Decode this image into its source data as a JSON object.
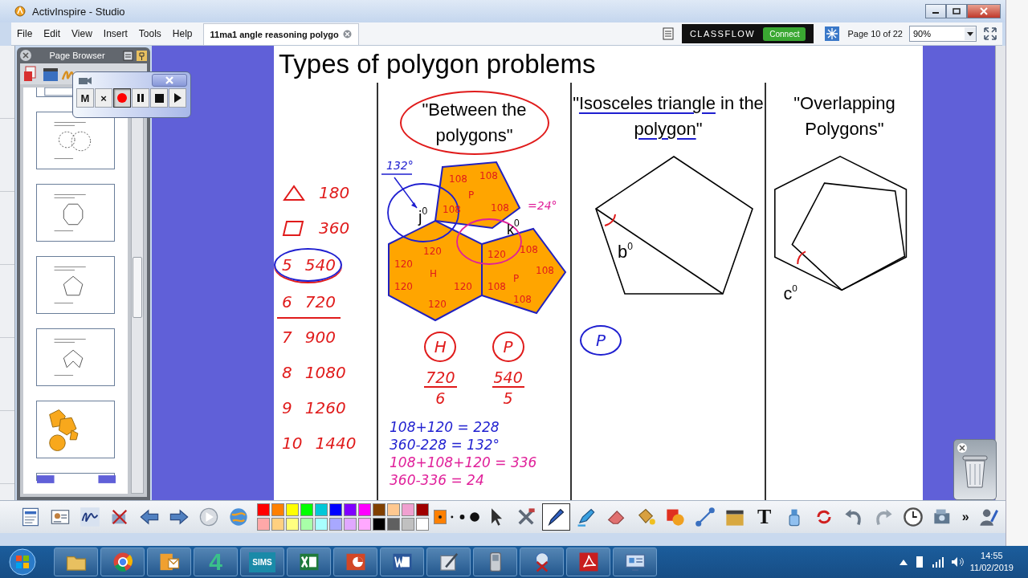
{
  "window": {
    "title": "ActivInspire - Studio"
  },
  "menu": [
    "File",
    "Edit",
    "View",
    "Insert",
    "Tools",
    "Help"
  ],
  "document_tab": {
    "title": "11ma1 angle reasoning polygo"
  },
  "classflow": {
    "logo": "CLASSFLOW",
    "button": "Connect"
  },
  "page_indicator": "Page 10 of 22",
  "zoom": {
    "value": "90%"
  },
  "page_browser": {
    "title": "Page Browser",
    "thumbnails": [
      {
        "kind": "blank"
      },
      {
        "kind": "circles"
      },
      {
        "kind": "octagon"
      },
      {
        "kind": "pentagon"
      },
      {
        "kind": "arrow"
      },
      {
        "kind": "orange"
      },
      {
        "kind": "purple"
      }
    ]
  },
  "recorder": {
    "buttons": [
      {
        "kind": "text",
        "label": "M",
        "selected": false
      },
      {
        "kind": "text",
        "label": "×",
        "selected": false
      },
      {
        "kind": "record",
        "selected": true
      },
      {
        "kind": "pause",
        "selected": false
      },
      {
        "kind": "stop",
        "selected": false
      },
      {
        "kind": "play",
        "selected": false
      }
    ]
  },
  "page": {
    "title": "Types of polygon problems",
    "angle_sums": [
      {
        "kind": "triangle",
        "total": "180",
        "circled": false,
        "underlined": false
      },
      {
        "kind": "square",
        "total": "360",
        "circled": false,
        "underlined": false
      },
      {
        "kind": "number",
        "sides": "5",
        "total": "540",
        "circled": true,
        "underlined": true
      },
      {
        "kind": "number",
        "sides": "6",
        "total": "720",
        "circled": false,
        "underlined": true
      },
      {
        "kind": "number",
        "sides": "7",
        "total": "900",
        "circled": false,
        "underlined": false
      },
      {
        "kind": "number",
        "sides": "8",
        "total": "1080",
        "circled": false,
        "underlined": false
      },
      {
        "kind": "number",
        "sides": "9",
        "total": "1260",
        "circled": false,
        "underlined": false
      },
      {
        "kind": "number",
        "sides": "10",
        "total": "1440",
        "circled": false,
        "underlined": false
      }
    ],
    "between": {
      "heading": "\"Between the polygons\"",
      "note": "132°",
      "j": {
        "letter": "j",
        "exponent": "0"
      },
      "k": {
        "letter": "k",
        "exponent": "0"
      },
      "k_note": "=24°",
      "shapes": [
        {
          "kind": "pentagon",
          "labels": [
            {
              "text": "108",
              "color": "#e01b1b"
            },
            {
              "text": "108",
              "color": "#e01b1b"
            },
            {
              "text": "P",
              "color": "#e01b1b"
            },
            {
              "text": "108",
              "color": "#e01b1b"
            },
            {
              "text": "108",
              "color": "#e01b1b"
            }
          ]
        },
        {
          "kind": "hexagon",
          "labels": [
            {
              "text": "120",
              "color": "#e01b1b"
            },
            {
              "text": "120",
              "color": "#e01b1b"
            },
            {
              "text": "H",
              "color": "#e01b1b"
            },
            {
              "text": "120",
              "color": "#e01b1b"
            },
            {
              "text": "120",
              "color": "#e01b1b"
            },
            {
              "text": "120",
              "color": "#e01b1b"
            }
          ]
        },
        {
          "kind": "pentagon",
          "labels": [
            {
              "text": "120",
              "color": "#e01b1b"
            },
            {
              "text": "108",
              "color": "#e01b1b"
            },
            {
              "text": "P",
              "color": "#e01b1b"
            },
            {
              "text": "108",
              "color": "#e01b1b"
            },
            {
              "text": "108",
              "color": "#e01b1b"
            },
            {
              "text": "108",
              "color": "#e01b1b"
            }
          ]
        }
      ],
      "fractions": [
        {
          "label": "H",
          "numerator": "720",
          "denominator": "6"
        },
        {
          "label": "P",
          "numerator": "540",
          "denominator": "5"
        }
      ],
      "working": [
        {
          "text": "108+120 = 228",
          "color": "#1f1fd0"
        },
        {
          "text": "360-228 = 132°",
          "color": "#1f1fd0"
        },
        {
          "text": "108+108+120 = 336",
          "color": "#e0209a"
        },
        {
          "text": "360-336 = 24",
          "color": "#e0209a"
        }
      ]
    },
    "isosceles": {
      "heading_parts": [
        {
          "text": "\"",
          "underlined": false
        },
        {
          "text": "Isosceles triangle",
          "underlined": true
        },
        {
          "text": " in the ",
          "underlined": false
        },
        {
          "text": "polygon",
          "underlined": true
        },
        {
          "text": "\"",
          "underlined": false
        }
      ],
      "angle": {
        "letter": "b",
        "exponent": "0"
      },
      "note": "P"
    },
    "overlapping": {
      "heading": "\"Overlapping Polygons\"",
      "angle": {
        "letter": "c",
        "exponent": "0"
      }
    }
  },
  "toolbar": {
    "left": [
      {
        "kind": "flipchart"
      },
      {
        "kind": "profile"
      },
      {
        "kind": "signature"
      },
      {
        "kind": "toolbox"
      },
      {
        "kind": "back"
      },
      {
        "kind": "forward"
      },
      {
        "kind": "play"
      },
      {
        "kind": "globe"
      }
    ],
    "palette": [
      {
        "color": "#ff0000"
      },
      {
        "color": "#ff8000"
      },
      {
        "color": "#ffff00"
      },
      {
        "color": "#00ff00"
      },
      {
        "color": "#00c8d8"
      },
      {
        "color": "#0000ff"
      },
      {
        "color": "#8000ff"
      },
      {
        "color": "#ff00ff"
      },
      {
        "color": "#804000"
      },
      {
        "color": "#ffc890"
      },
      {
        "color": "#f0a0d0"
      },
      {
        "color": "#a00000"
      },
      {
        "color": "#ffa8a8"
      },
      {
        "color": "#ffd080"
      },
      {
        "color": "#ffff80"
      },
      {
        "color": "#a8ffa8"
      },
      {
        "color": "#a8ffff"
      },
      {
        "color": "#a8a8ff"
      },
      {
        "color": "#e0a8ff"
      },
      {
        "color": "#ffa8ff"
      },
      {
        "color": "#000000"
      },
      {
        "color": "#606060"
      },
      {
        "color": "#c0c0c0"
      },
      {
        "color": "#ffffff"
      }
    ],
    "current": {
      "color": "#ff8000"
    },
    "tools": [
      {
        "kind": "pointer",
        "selected": false
      },
      {
        "kind": "tools",
        "selected": false
      },
      {
        "kind": "pen",
        "selected": true
      },
      {
        "kind": "highlighter",
        "selected": false
      },
      {
        "kind": "eraser",
        "selected": false
      },
      {
        "kind": "fill",
        "selected": false
      },
      {
        "kind": "shape",
        "selected": false
      },
      {
        "kind": "connector",
        "selected": false
      },
      {
        "kind": "clip",
        "selected": false
      },
      {
        "kind": "text",
        "label": "T",
        "selected": false
      },
      {
        "kind": "clear",
        "selected": false
      },
      {
        "kind": "reset",
        "selected": false
      },
      {
        "kind": "undo",
        "selected": false
      },
      {
        "kind": "redo",
        "selected": false
      },
      {
        "kind": "clock",
        "selected": false
      },
      {
        "kind": "camera",
        "selected": false
      },
      {
        "kind": "more",
        "label": "»",
        "selected": false
      },
      {
        "kind": "profile_pen",
        "selected": false
      }
    ]
  },
  "taskbar": {
    "apps": [
      {
        "kind": "folder"
      },
      {
        "kind": "chrome"
      },
      {
        "kind": "outlook"
      },
      {
        "kind": "label",
        "label": "4"
      },
      {
        "kind": "label",
        "label": "SIMS"
      },
      {
        "kind": "excel"
      },
      {
        "kind": "powerpoint"
      },
      {
        "kind": "word"
      },
      {
        "kind": "tool"
      },
      {
        "kind": "phone"
      },
      {
        "kind": "snipping"
      },
      {
        "kind": "acrobat"
      },
      {
        "kind": "remote"
      }
    ],
    "time": "14:55",
    "date": "11/02/2019"
  }
}
